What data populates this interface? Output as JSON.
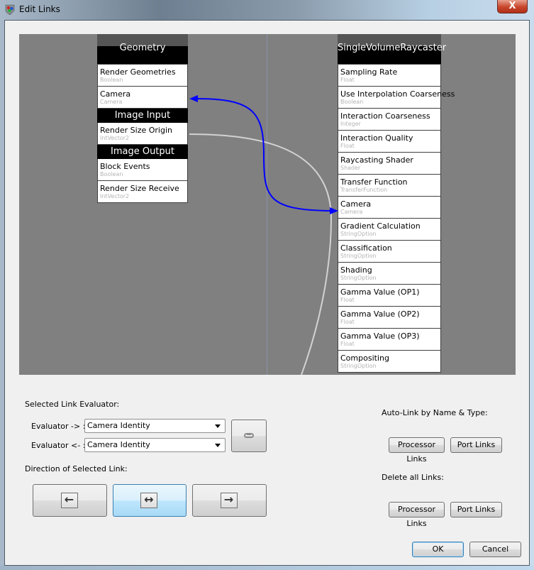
{
  "window": {
    "title": "Edit Links",
    "close_label": "X"
  },
  "canvas": {
    "left_processor": {
      "name": "Geometry Processor",
      "properties": [
        {
          "name": "Render Geometries",
          "type": "Boolean"
        },
        {
          "name": "Camera",
          "type": "Camera"
        }
      ],
      "image_input_header": "Image Input",
      "image_input_properties": [
        {
          "name": "Render Size Origin",
          "type": "IntVector2"
        }
      ],
      "image_output_header": "Image Output",
      "image_output_properties": [
        {
          "name": "Block Events",
          "type": "Boolean"
        },
        {
          "name": "Render Size Receive",
          "type": "IntVector2"
        }
      ]
    },
    "right_processor": {
      "name": "SingleVolumeRaycaster",
      "properties": [
        {
          "name": "Sampling Rate",
          "type": "Float"
        },
        {
          "name": "Use Interpolation Coarseness",
          "type": "Boolean"
        },
        {
          "name": "Interaction Coarseness",
          "type": "Integer"
        },
        {
          "name": "Interaction Quality",
          "type": "Float"
        },
        {
          "name": "Raycasting Shader",
          "type": "Shader"
        },
        {
          "name": "Transfer Function",
          "type": "TransferFunction"
        },
        {
          "name": "Camera",
          "type": "Camera"
        },
        {
          "name": "Gradient Calculation",
          "type": "StringOption"
        },
        {
          "name": "Classification",
          "type": "StringOption"
        },
        {
          "name": "Shading",
          "type": "StringOption"
        },
        {
          "name": "Gamma Value (OP1)",
          "type": "Float"
        },
        {
          "name": "Gamma Value (OP2)",
          "type": "Float"
        },
        {
          "name": "Gamma Value (OP3)",
          "type": "Float"
        },
        {
          "name": "Compositing",
          "type": "StringOption"
        }
      ]
    },
    "links": [
      {
        "from": "Geometry Processor.Camera",
        "to": "SingleVolumeRaycaster.Camera",
        "direction": "bidirectional",
        "color": "#0000ff",
        "selected": true
      },
      {
        "from": "Geometry Processor.Render Size Origin",
        "to": "offscreen",
        "color": "#d0d0d0",
        "selected": false
      }
    ]
  },
  "evaluator": {
    "section_label": "Selected Link Evaluator:",
    "forward_label": "Evaluator -> :",
    "forward_value": "Camera Identity",
    "backward_label": "Evaluator <- :",
    "backward_value": "Camera Identity",
    "link_button_icon": "chain-link-icon"
  },
  "direction": {
    "section_label": "Direction of Selected Link:",
    "buttons": [
      {
        "icon": "arrow-left-icon",
        "glyph": "←",
        "active": false
      },
      {
        "icon": "arrow-both-icon",
        "glyph": "↔",
        "active": true
      },
      {
        "icon": "arrow-right-icon",
        "glyph": "→",
        "active": false
      }
    ]
  },
  "autolink": {
    "section_label": "Auto-Link by Name & Type:",
    "processor_links": "Processor Links",
    "port_links": "Port Links"
  },
  "delete_links": {
    "section_label": "Delete all Links:",
    "processor_links": "Processor Links",
    "port_links": "Port Links"
  },
  "footer": {
    "ok": "OK",
    "cancel": "Cancel"
  }
}
